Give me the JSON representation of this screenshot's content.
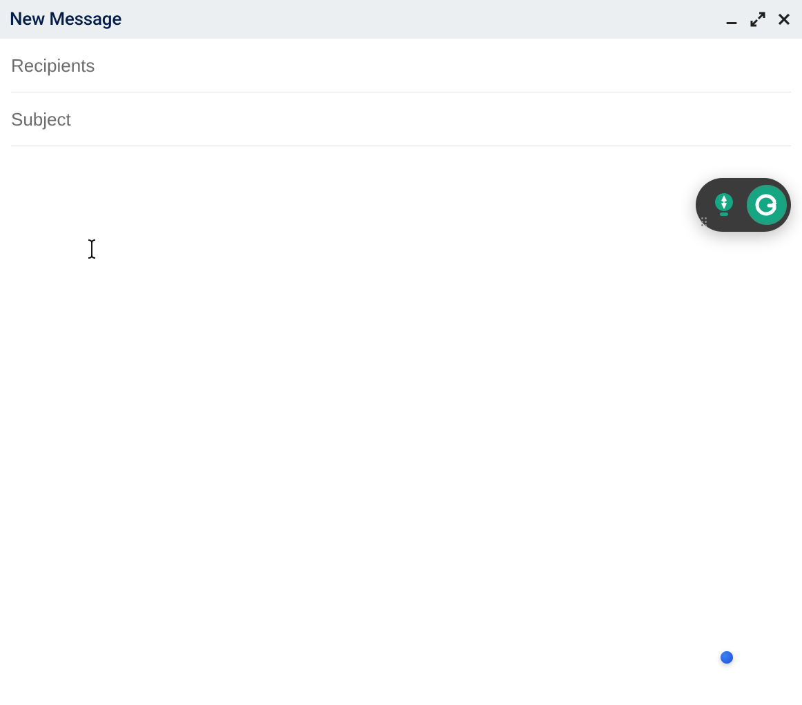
{
  "header": {
    "title": "New Message"
  },
  "fields": {
    "recipients": {
      "placeholder": "Recipients",
      "value": ""
    },
    "subject": {
      "placeholder": "Subject",
      "value": ""
    }
  },
  "body": {
    "value": ""
  },
  "icons": {
    "minimize": "minimize",
    "expand": "expand",
    "close": "close",
    "lightbulb": "lightbulb",
    "grammarly": "G"
  }
}
